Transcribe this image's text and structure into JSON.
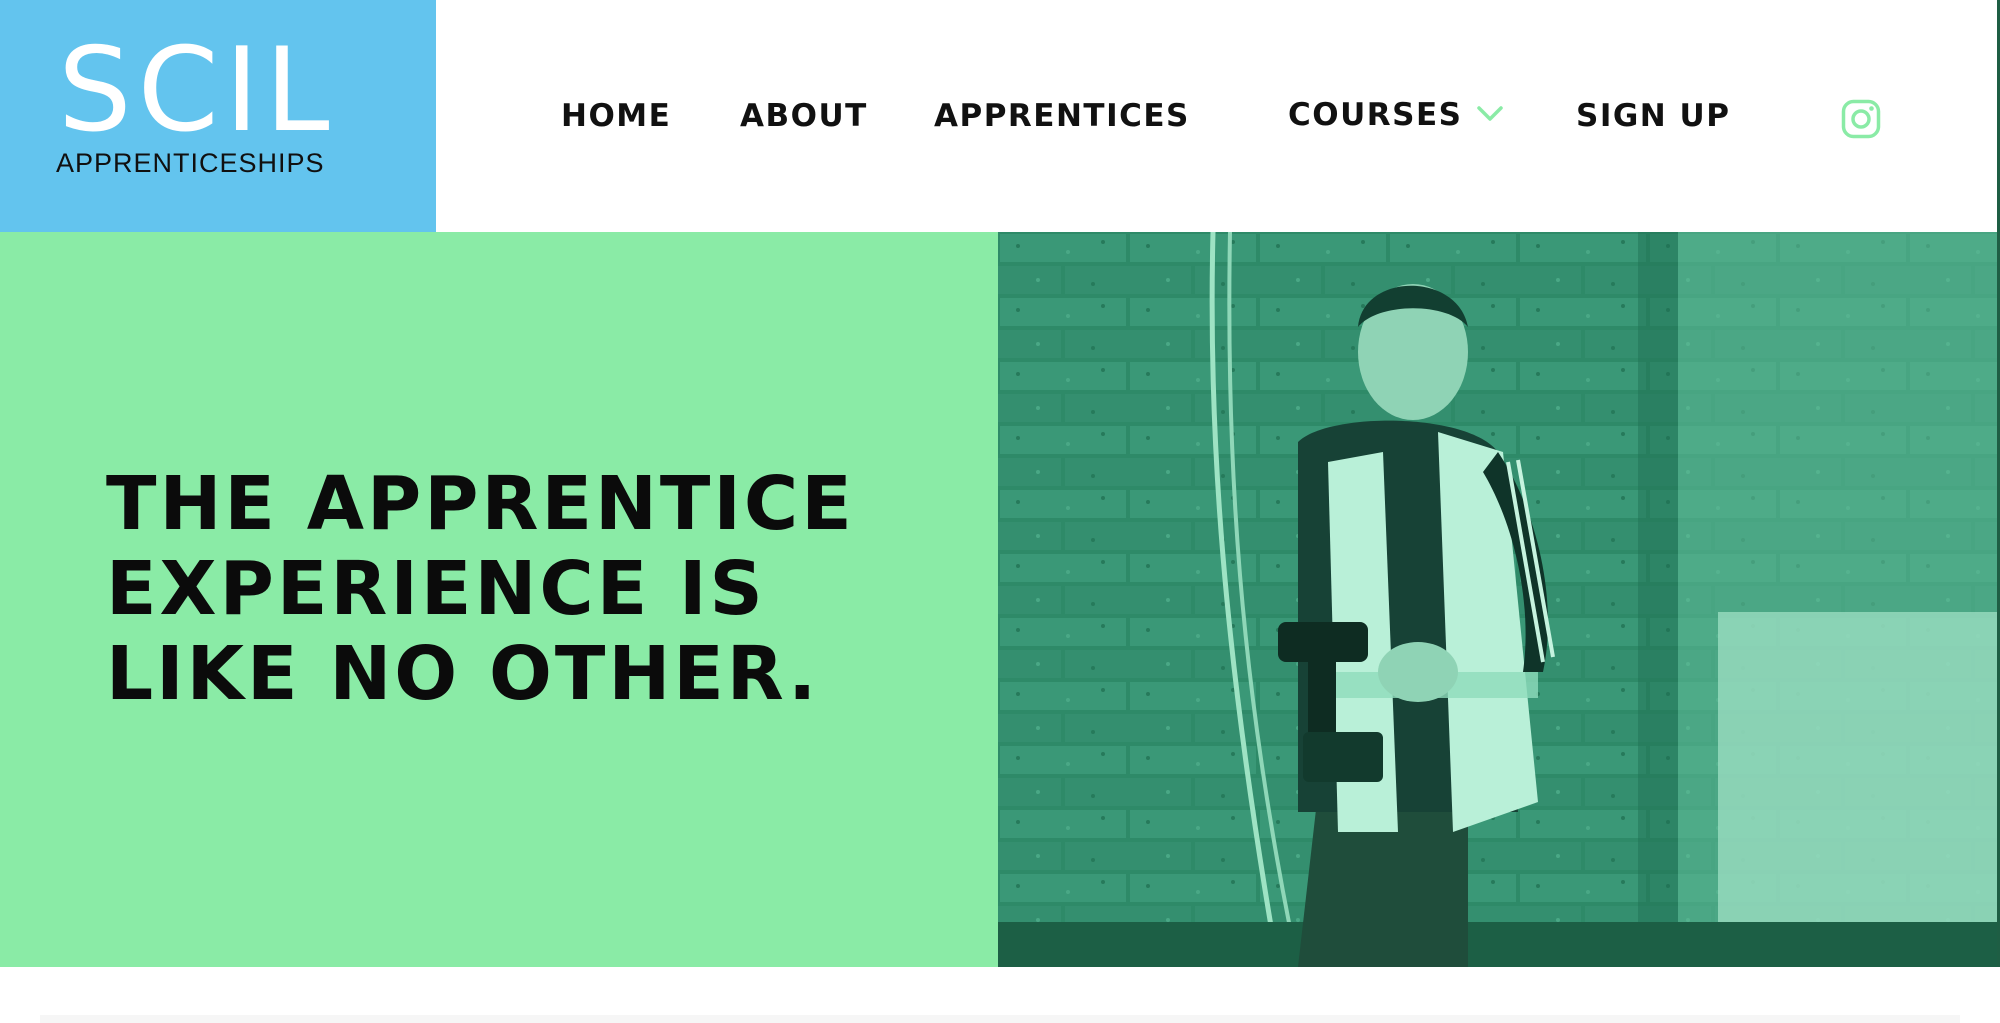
{
  "brand": {
    "logo_mark": "SCIL",
    "logo_subtitle": "APPRENTICESHIPS",
    "logo_bg": "#63c4ee",
    "accent_green": "#8aeba6"
  },
  "nav": {
    "home": "HOME",
    "about": "ABOUT",
    "apprentices": "APPRENTICES",
    "courses": "COURSES",
    "signup": "SIGN UP",
    "courses_icon": "chevron-down-icon",
    "social_icon": "instagram-icon"
  },
  "hero": {
    "title_lines": [
      "THE APPRENTICE",
      "EXPERIENCE IS",
      "LIKE NO OTHER."
    ]
  }
}
